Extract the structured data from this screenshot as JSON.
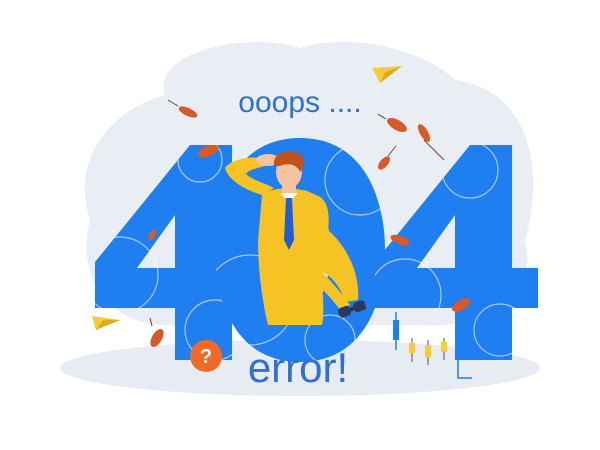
{
  "headline": "ooops ....",
  "digits": [
    "4",
    "0",
    "4"
  ],
  "subline": "error!",
  "question_badge": "?",
  "colors": {
    "blob": "#e9edf4",
    "digit_fill": "#1f7ef0",
    "text": "#2f6fd6",
    "shirt": "#f5c323",
    "tie": "#1f5fd0",
    "hair": "#c2511b",
    "leaf": "#d85a29",
    "badge": "#f26a2a",
    "plane": "#f6cd35"
  },
  "icons": [
    "paper-plane-icon",
    "leaf-icon",
    "question-icon",
    "binoculars-icon",
    "candlestick-chart-icon"
  ]
}
